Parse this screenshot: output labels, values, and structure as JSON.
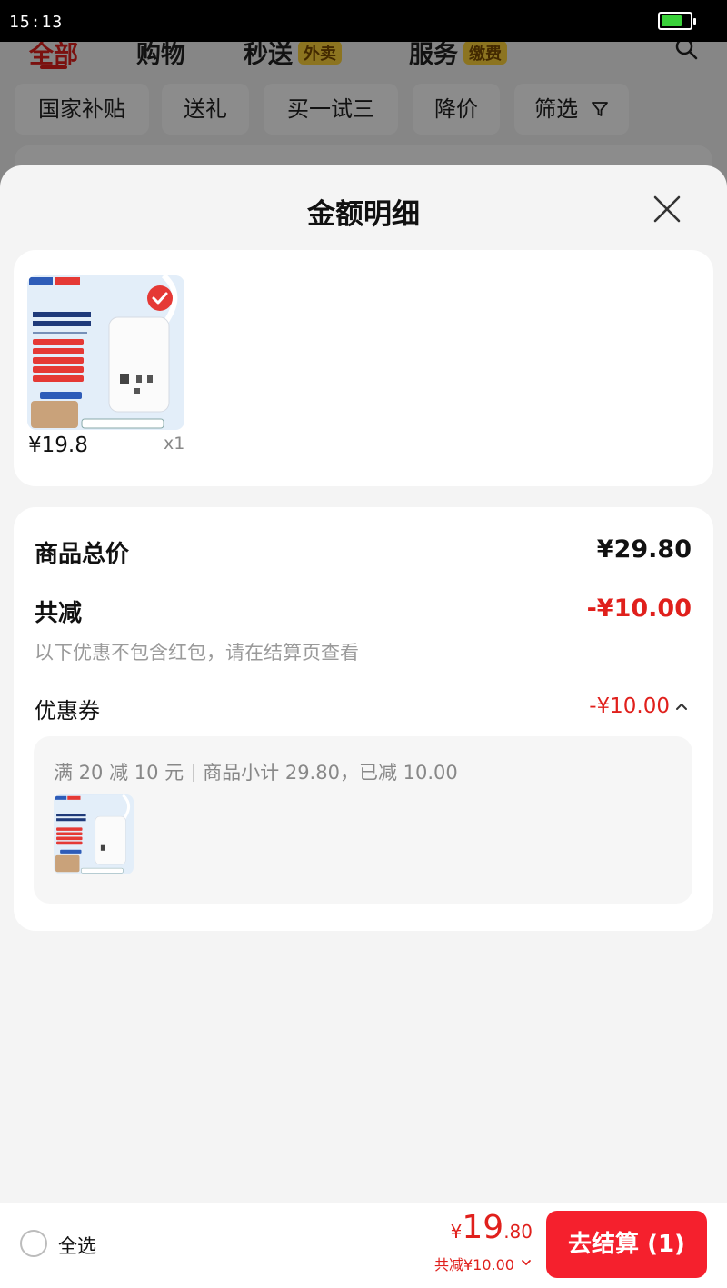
{
  "status_bar": {
    "time": "15:13",
    "battery_level": 0.75
  },
  "background": {
    "tabs": [
      {
        "label": "全部",
        "badge": ""
      },
      {
        "label": "购物",
        "badge": ""
      },
      {
        "label": "秒送",
        "badge": "外卖"
      },
      {
        "label": "服务",
        "badge": "缴费"
      }
    ],
    "filters": [
      "国家补贴",
      "送礼",
      "买一试三",
      "降价",
      "筛选"
    ]
  },
  "sheet": {
    "title": "金额明细",
    "product": {
      "price": "¥19.8",
      "qty": "x1",
      "image_icon": "power-strip-product-image"
    },
    "summary": {
      "total_label": "商品总价",
      "total_value": "¥29.80",
      "discount_label": "共减",
      "discount_value": "-¥10.00",
      "note": "以下优惠不包含红包，请在结算页查看",
      "coupon_label": "优惠券",
      "coupon_value": "-¥10.00",
      "coupon_rule": "满 20 减 10 元",
      "coupon_detail": "商品小计 29.80，已减 10.00"
    }
  },
  "bottom": {
    "select_all": "全选",
    "currency": "¥",
    "price_int": "19",
    "price_dec": ".80",
    "discount_line": "共减¥10.00",
    "checkout_label": "去结算 (1)"
  },
  "colors": {
    "accent": "#e0201c",
    "button": "#f5202d",
    "battery": "#3ad13a"
  }
}
